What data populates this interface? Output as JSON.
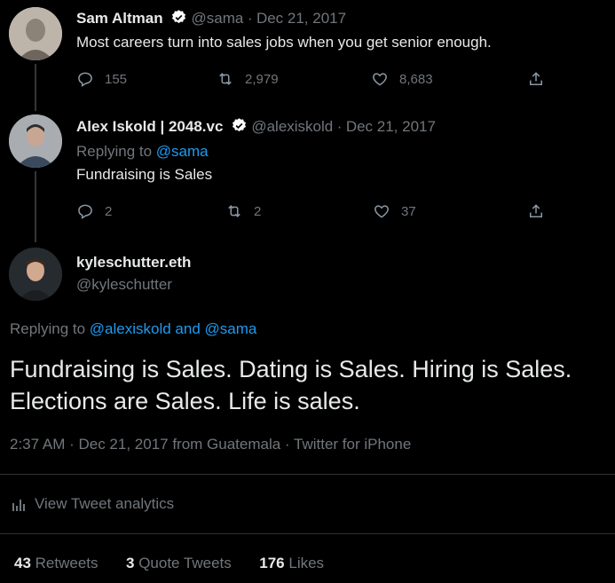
{
  "tweets": [
    {
      "name": "Sam Altman",
      "handle": "@sama",
      "date": "Dec 21, 2017",
      "text": "Most careers turn into sales jobs when you get senior enough.",
      "replies": "155",
      "retweets": "2,979",
      "likes": "8,683"
    },
    {
      "name": "Alex Iskold | 2048.vc",
      "handle": "@alexiskold",
      "date": "Dec 21, 2017",
      "replying_prefix": "Replying to ",
      "replying_to": "@sama",
      "text": "Fundraising is Sales",
      "replies": "2",
      "retweets": "2",
      "likes": "37"
    }
  ],
  "main": {
    "name": "kyleschutter.eth",
    "handle": "@kyleschutter",
    "replying_prefix": "Replying to ",
    "replying_to": "@alexiskold and @sama",
    "text_line1": "Fundraising is Sales. Dating is Sales. Hiring is Sales.",
    "text_line2": "Elections are Sales. Life is sales.",
    "meta": "2:37 AM · Dec 21, 2017 from Guatemala · Twitter for iPhone",
    "analytics_label": "View Tweet analytics",
    "stats": {
      "retweets_count": "43",
      "retweets_label": "Retweets",
      "quotes_count": "3",
      "quotes_label": "Quote Tweets",
      "likes_count": "176",
      "likes_label": "Likes"
    }
  },
  "sep": "·",
  "colors": {
    "background": "#000000",
    "text": "#e7e9ea",
    "muted": "#71767b",
    "link": "#1d9bf0",
    "verified": "#ffffff"
  },
  "icons": [
    "reply-icon",
    "retweet-icon",
    "like-icon",
    "share-icon",
    "verified-icon",
    "analytics-icon"
  ]
}
